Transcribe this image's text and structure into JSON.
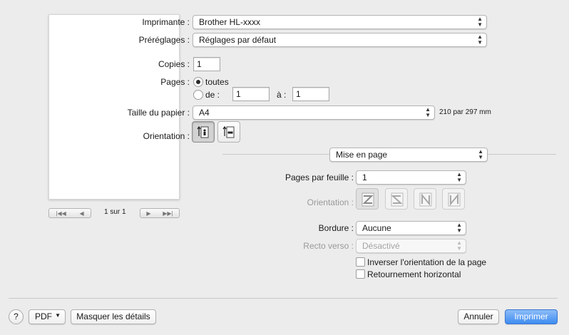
{
  "printer": {
    "label": "Imprimante :",
    "value": "Brother HL-xxxx"
  },
  "presets": {
    "label": "Préréglages :",
    "value": "Réglages par défaut"
  },
  "copies": {
    "label": "Copies :",
    "value": "1"
  },
  "pages": {
    "label": "Pages :",
    "all_label": "toutes",
    "range_label": "de :",
    "from": "1",
    "to_label": "à :",
    "to": "1",
    "selected": "all"
  },
  "paper_size": {
    "label": "Taille du papier :",
    "value": "A4",
    "dimensions": "210 par 297 mm"
  },
  "orientation": {
    "label": "Orientation :",
    "selected": "portrait"
  },
  "section": {
    "value": "Mise en page"
  },
  "layout": {
    "pages_per_sheet_label": "Pages par feuille :",
    "pages_per_sheet_value": "1",
    "direction_label": "Orientation :",
    "border_label": "Bordure :",
    "border_value": "Aucune",
    "duplex_label": "Recto verso :",
    "duplex_value": "Désactivé",
    "reverse_label": "Inverser l'orientation de la page",
    "flip_label": "Retournement horizontal"
  },
  "preview": {
    "page_counter": "1 sur 1"
  },
  "footer": {
    "help": "?",
    "pdf": "PDF",
    "hide_details": "Masquer les détails",
    "cancel": "Annuler",
    "print": "Imprimer"
  },
  "colors": {
    "accent": "#3f8cf0",
    "background": "#ececec"
  }
}
